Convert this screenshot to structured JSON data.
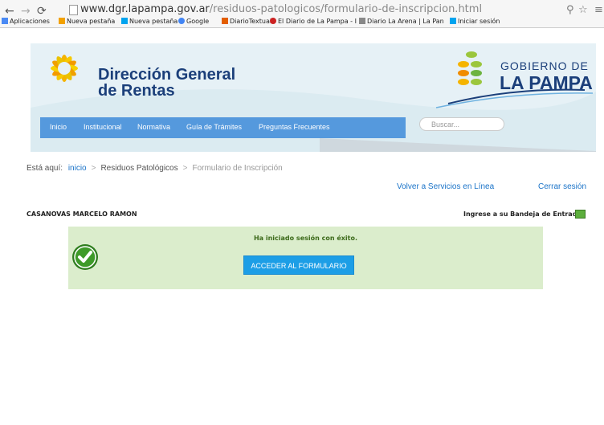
{
  "browser": {
    "url_domain": "www.dgr.lapampa.gov.ar",
    "url_path": "/residuos-patologicos/formulario-de-inscripcion.html",
    "bookmarks": [
      "Aplicaciones",
      "Nueva pestaña",
      "Nueva pestaña",
      "Google",
      "DiarioTextual",
      "El Diario de La Pampa - I",
      "Diario La Arena | La Pan",
      "Iniciar sesión"
    ]
  },
  "header": {
    "logo_line1": "Dirección General",
    "logo_line2": "de Rentas",
    "gov_line1": "GOBIERNO DE",
    "gov_line2": "LA PAMPA",
    "menu": [
      "Inicio",
      "Institucional",
      "Normativa",
      "Guía de Trámites",
      "Preguntas Frecuentes"
    ],
    "search_placeholder": "Buscar..."
  },
  "breadcrumb": {
    "label": "Está aquí:",
    "items": [
      "inicio",
      "Residuos Patológicos",
      "Formulario de Inscripción"
    ]
  },
  "links": {
    "back": "Volver a Servicios en Línea",
    "logout": "Cerrar sesión"
  },
  "user": {
    "name": "CASANOVAS MARCELO RAMON",
    "inbox": "Ingrese a su Bandeja de Entrada"
  },
  "panel": {
    "message": "Ha iniciado sesión con éxito.",
    "button": "ACCEDER AL FORMULARIO"
  },
  "colors": {
    "menu_bg": "#5599dd",
    "panel_bg": "#dbedcc",
    "button_bg": "#1c9ee6",
    "brand": "#1b3f7a"
  }
}
